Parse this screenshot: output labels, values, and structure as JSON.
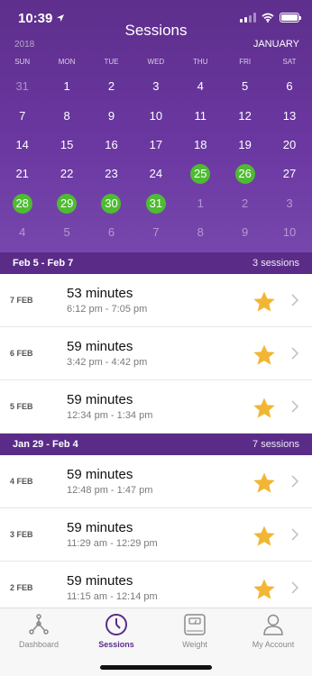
{
  "status": {
    "time": "10:39"
  },
  "header": {
    "title": "Sessions",
    "year": "2018",
    "month": "JANUARY"
  },
  "calendar": {
    "weekdays": [
      "SUN",
      "MON",
      "TUE",
      "WED",
      "THU",
      "FRI",
      "SAT"
    ],
    "weeks": [
      [
        {
          "d": "31",
          "s": "dim"
        },
        {
          "d": "1",
          "s": ""
        },
        {
          "d": "2",
          "s": ""
        },
        {
          "d": "3",
          "s": ""
        },
        {
          "d": "4",
          "s": ""
        },
        {
          "d": "5",
          "s": ""
        },
        {
          "d": "6",
          "s": ""
        }
      ],
      [
        {
          "d": "7",
          "s": ""
        },
        {
          "d": "8",
          "s": ""
        },
        {
          "d": "9",
          "s": ""
        },
        {
          "d": "10",
          "s": ""
        },
        {
          "d": "11",
          "s": ""
        },
        {
          "d": "12",
          "s": ""
        },
        {
          "d": "13",
          "s": ""
        }
      ],
      [
        {
          "d": "14",
          "s": ""
        },
        {
          "d": "15",
          "s": ""
        },
        {
          "d": "16",
          "s": ""
        },
        {
          "d": "17",
          "s": ""
        },
        {
          "d": "18",
          "s": ""
        },
        {
          "d": "19",
          "s": ""
        },
        {
          "d": "20",
          "s": ""
        }
      ],
      [
        {
          "d": "21",
          "s": ""
        },
        {
          "d": "22",
          "s": ""
        },
        {
          "d": "23",
          "s": ""
        },
        {
          "d": "24",
          "s": ""
        },
        {
          "d": "25",
          "s": "active"
        },
        {
          "d": "26",
          "s": "active"
        },
        {
          "d": "27",
          "s": ""
        }
      ],
      [
        {
          "d": "28",
          "s": "active"
        },
        {
          "d": "29",
          "s": "active"
        },
        {
          "d": "30",
          "s": "active"
        },
        {
          "d": "31",
          "s": "active"
        },
        {
          "d": "1",
          "s": "dim"
        },
        {
          "d": "2",
          "s": "dim"
        },
        {
          "d": "3",
          "s": "dim"
        }
      ],
      [
        {
          "d": "4",
          "s": "dim"
        },
        {
          "d": "5",
          "s": "dim"
        },
        {
          "d": "6",
          "s": "dim"
        },
        {
          "d": "7",
          "s": "dim"
        },
        {
          "d": "8",
          "s": "dim"
        },
        {
          "d": "9",
          "s": "dim"
        },
        {
          "d": "10",
          "s": "dim"
        }
      ]
    ]
  },
  "groups": [
    {
      "range": "Feb 5 - Feb 7",
      "count": "3 sessions",
      "sessions": [
        {
          "date": "7 FEB",
          "duration": "53 minutes",
          "span": "6:12 pm - 7:05 pm"
        },
        {
          "date": "6 FEB",
          "duration": "59 minutes",
          "span": "3:42 pm - 4:42 pm"
        },
        {
          "date": "5 FEB",
          "duration": "59 minutes",
          "span": "12:34 pm - 1:34 pm"
        }
      ]
    },
    {
      "range": "Jan 29 - Feb 4",
      "count": "7 sessions",
      "sessions": [
        {
          "date": "4 FEB",
          "duration": "59 minutes",
          "span": "12:48 pm - 1:47 pm"
        },
        {
          "date": "3 FEB",
          "duration": "59 minutes",
          "span": "11:29 am - 12:29 pm"
        },
        {
          "date": "2 FEB",
          "duration": "59 minutes",
          "span": "11:15 am - 12:14 pm"
        }
      ]
    }
  ],
  "tabs": [
    {
      "label": "Dashboard",
      "icon": "dashboard-icon",
      "active": false
    },
    {
      "label": "Sessions",
      "icon": "clock-icon",
      "active": true
    },
    {
      "label": "Weight",
      "icon": "scale-icon",
      "active": false
    },
    {
      "label": "My Account",
      "icon": "account-icon",
      "active": false
    }
  ],
  "colors": {
    "header": "#6a37a0",
    "section": "#5a2c88",
    "active_day": "#4fbb33",
    "star": "#f1b634",
    "tab_active": "#5a2c88"
  }
}
